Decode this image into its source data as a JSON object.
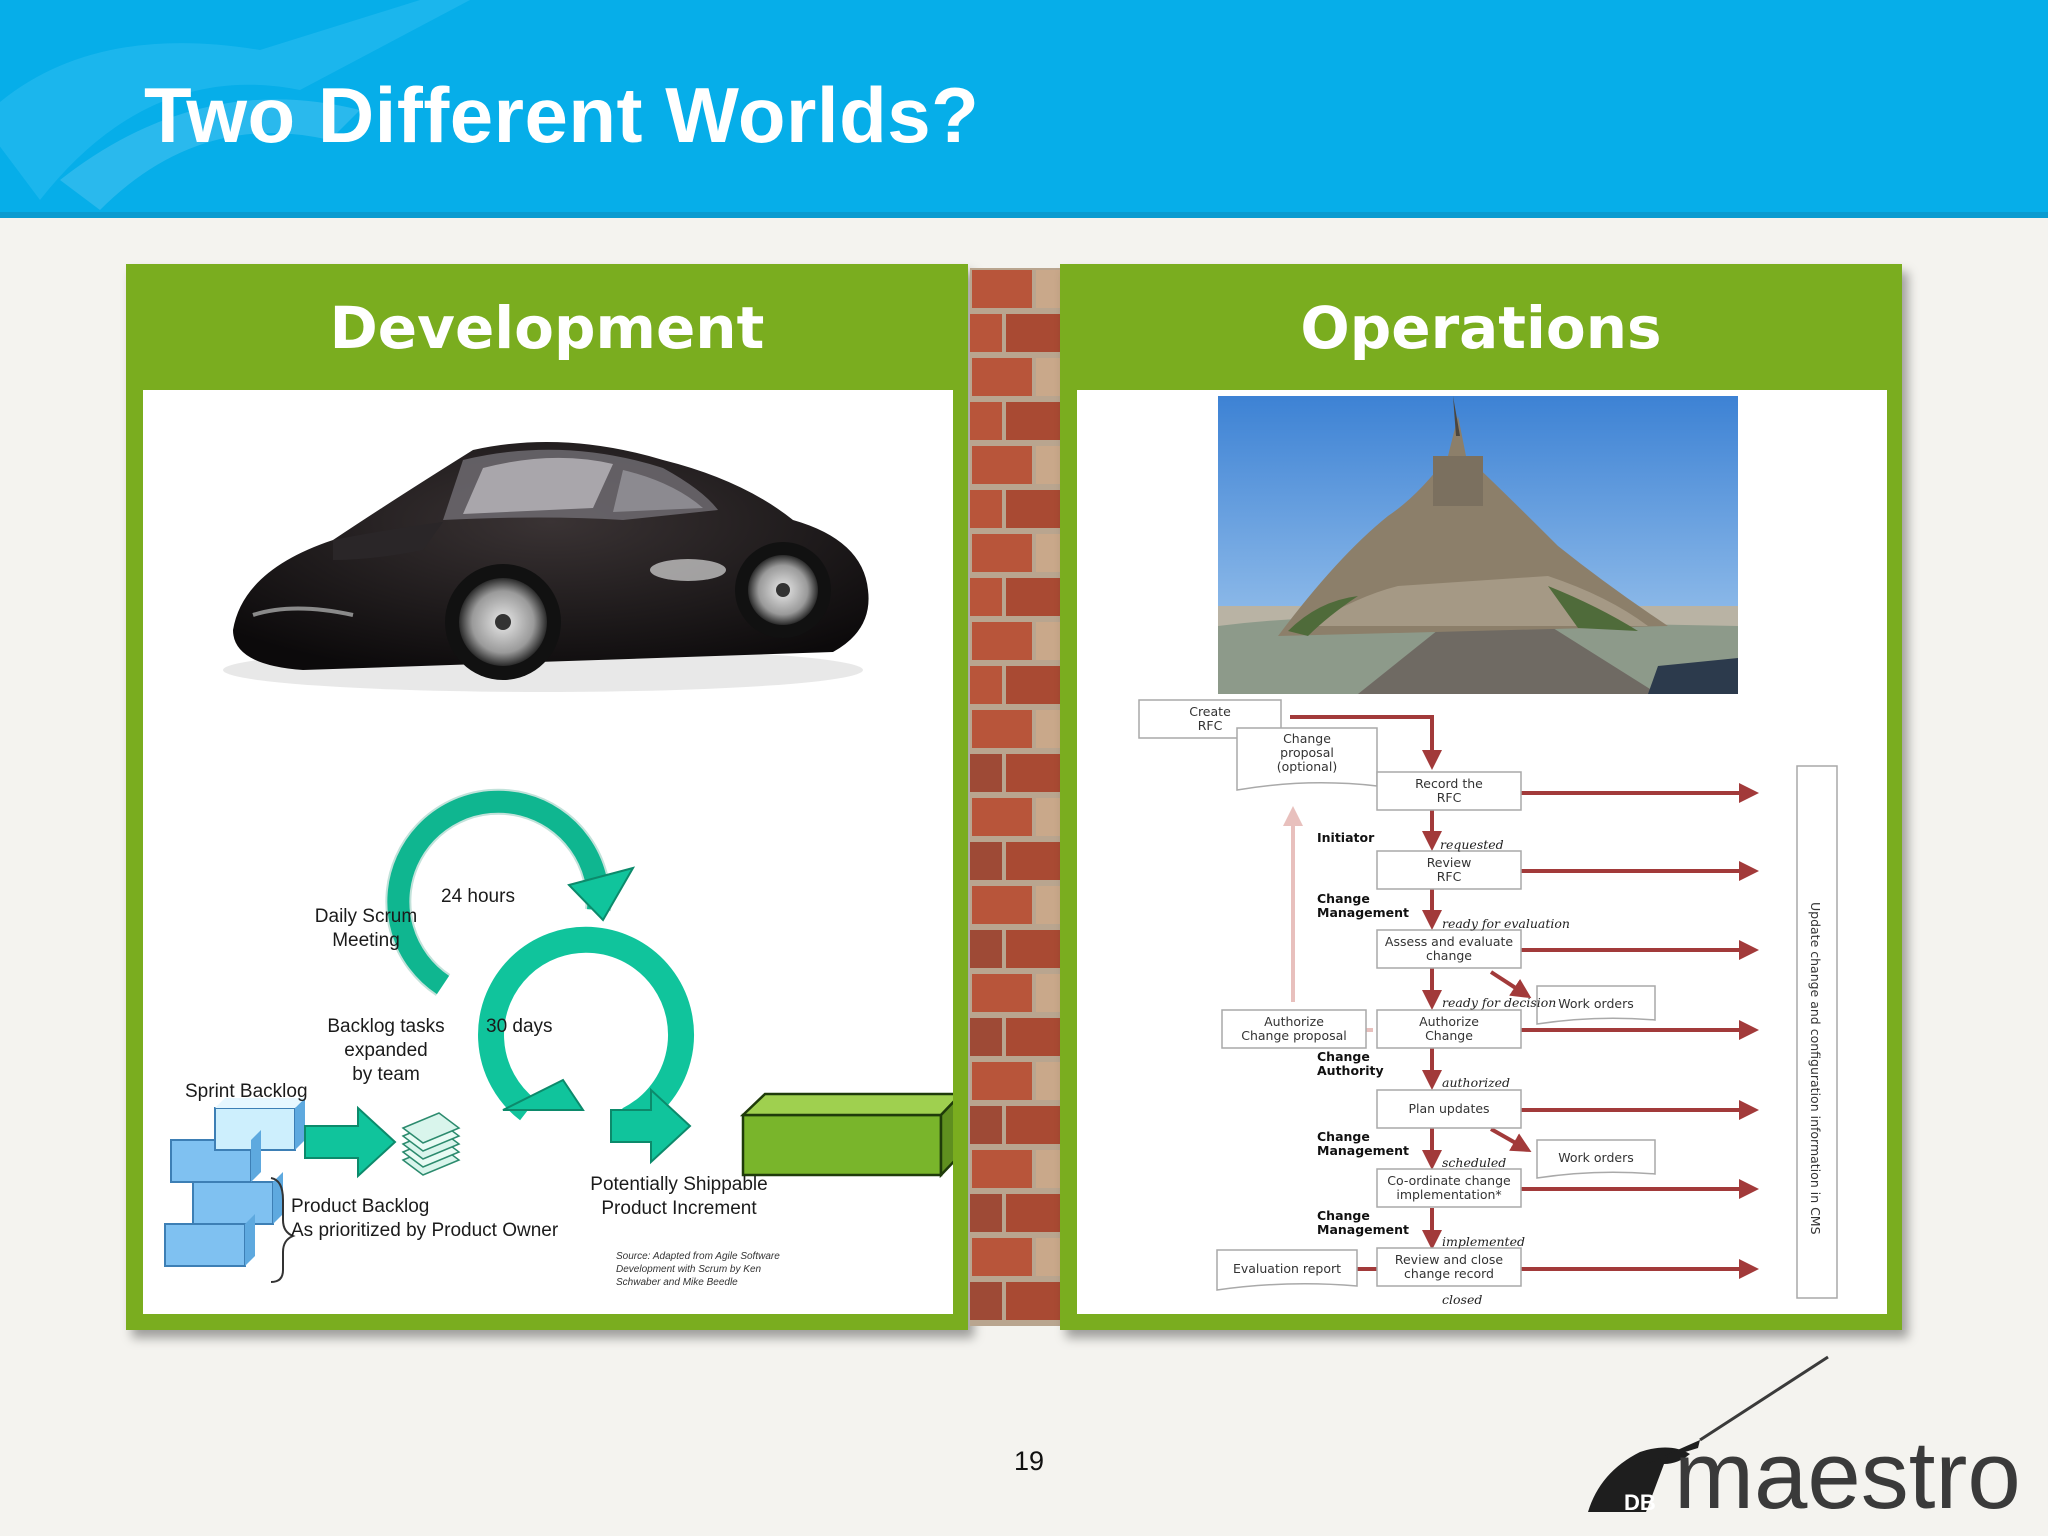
{
  "slide": {
    "title": "Two Different Worlds?",
    "page_number": "19"
  },
  "development": {
    "title": "Development",
    "scrum": {
      "sprint_backlog": "Sprint Backlog",
      "daily_scrum_1": "Daily Scrum",
      "daily_scrum_2": "Meeting",
      "hours": "24 hours",
      "days": "30 days",
      "tasks_1": "Backlog tasks",
      "tasks_2": "expanded",
      "tasks_3": "by team",
      "product_backlog_1": "Product Backlog",
      "product_backlog_2": "As prioritized by Product Owner",
      "increment_1": "Potentially Shippable",
      "increment_2": "Product Increment",
      "source_1": "Source: Adapted from Agile Software",
      "source_2": "Development with Scrum by Ken",
      "source_3": "Schwaber and Mike Beedle"
    }
  },
  "operations": {
    "title": "Operations",
    "flow": {
      "create_rfc_1": "Create",
      "create_rfc_2": "RFC",
      "change_proposal_1": "Change",
      "change_proposal_2": "proposal",
      "change_proposal_3": "(optional)",
      "record_1": "Record the",
      "record_2": "RFC",
      "review_1": "Review",
      "review_2": "RFC",
      "assess_1": "Assess and evaluate",
      "assess_2": "change",
      "authorize_1": "Authorize",
      "authorize_2": "Change",
      "auth_proposal_1": "Authorize",
      "auth_proposal_2": "Change proposal",
      "plan": "Plan updates",
      "coord_1": "Co-ordinate change",
      "coord_2": "implementation*",
      "review_close_1": "Review and close",
      "review_close_2": "change record",
      "evaluation_report": "Evaluation report",
      "work_orders_1": "Work orders",
      "work_orders_2": "Work orders",
      "role_initiator": "Initiator",
      "role_cm_1a": "Change",
      "role_cm_1b": "Management",
      "role_ca_a": "Change",
      "role_ca_b": "Authority",
      "role_cm_2a": "Change",
      "role_cm_2b": "Management",
      "role_cm_3a": "Change",
      "role_cm_3b": "Management",
      "st_requested": "requested",
      "st_ready_eval": "ready for evaluation",
      "st_ready_decision": "ready for decision",
      "st_authorized": "authorized",
      "st_scheduled": "scheduled",
      "st_implemented": "implemented",
      "st_closed": "closed",
      "cms_update": "Update change and configuration information in CMS"
    }
  },
  "logo": {
    "brand": "maestro",
    "prefix": "DB"
  }
}
